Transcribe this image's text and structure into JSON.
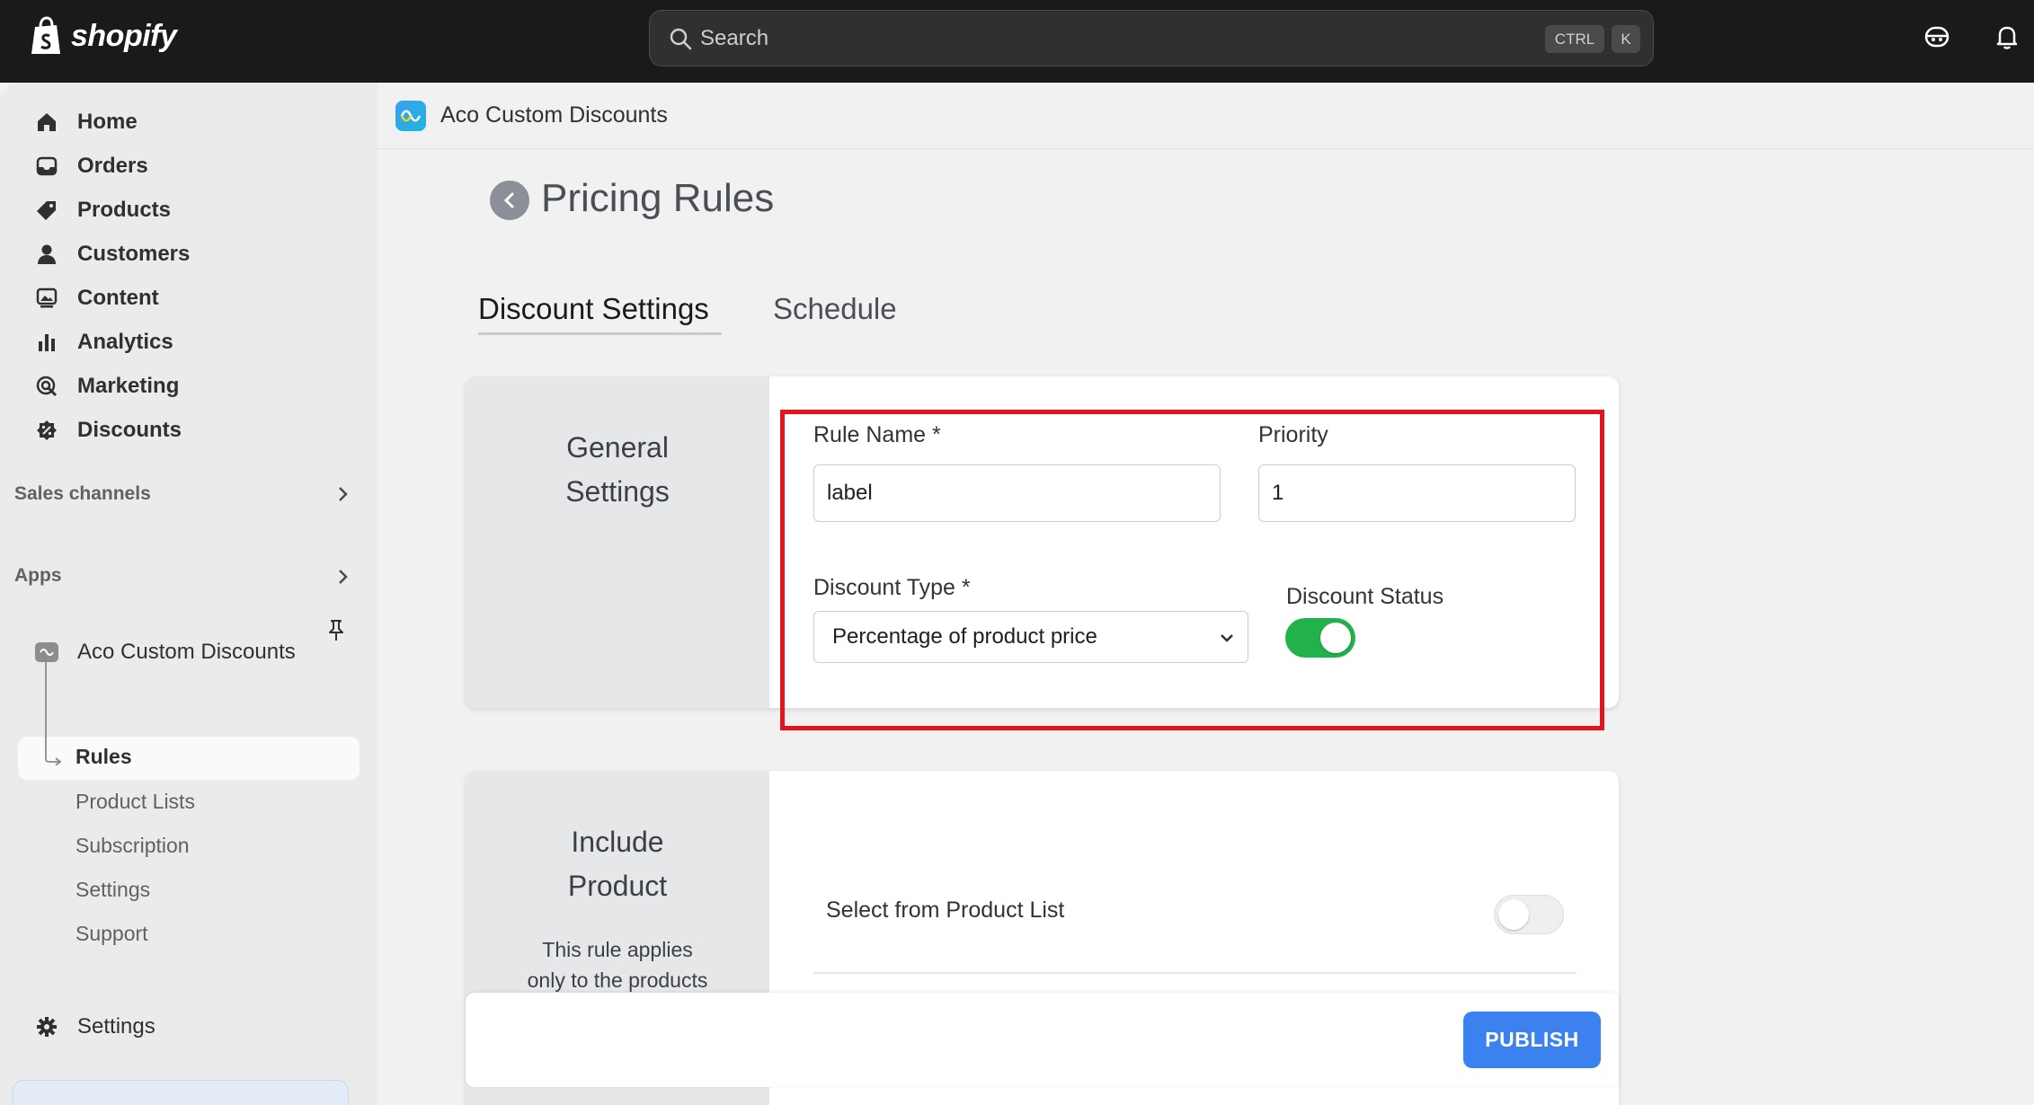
{
  "topbar": {
    "logo_text": "shopify",
    "search_placeholder": "Search",
    "kbd_ctrl": "CTRL",
    "kbd_k": "K"
  },
  "sidebar": {
    "items": [
      {
        "label": "Home",
        "icon": "home-icon"
      },
      {
        "label": "Orders",
        "icon": "inbox-icon"
      },
      {
        "label": "Products",
        "icon": "tag-icon"
      },
      {
        "label": "Customers",
        "icon": "person-icon"
      },
      {
        "label": "Content",
        "icon": "image-icon"
      },
      {
        "label": "Analytics",
        "icon": "bar-chart-icon"
      },
      {
        "label": "Marketing",
        "icon": "target-icon"
      },
      {
        "label": "Discounts",
        "icon": "discount-icon"
      }
    ],
    "sales_channels_label": "Sales channels",
    "apps_label": "Apps",
    "app_name": "Aco Custom Discounts",
    "app_subitems": [
      "Rules",
      "Product Lists",
      "Subscription",
      "Settings",
      "Support"
    ],
    "settings_label": "Settings"
  },
  "main": {
    "app_header_title": "Aco Custom Discounts",
    "page_title": "Pricing Rules",
    "tabs": [
      {
        "label": "Discount Settings",
        "active": true
      },
      {
        "label": "Schedule",
        "active": false
      }
    ],
    "general_settings": {
      "title_line1": "General",
      "title_line2": "Settings",
      "rule_name_label": "Rule Name *",
      "rule_name_value": "label",
      "priority_label": "Priority",
      "priority_value": "1",
      "discount_type_label": "Discount Type *",
      "discount_type_value": "Percentage of product price",
      "discount_status_label": "Discount Status",
      "discount_status_on": true
    },
    "include_product": {
      "title_line1": "Include",
      "title_line2": "Product",
      "desc_line1": "This rule applies",
      "desc_line2": "only to the products",
      "select_from_list_label": "Select from Product List",
      "select_from_list_on": false
    },
    "publish_label": "PUBLISH"
  },
  "colors": {
    "accent_green": "#22b24c",
    "publish_blue": "#3b82f0",
    "highlight_red": "#e4141d"
  }
}
